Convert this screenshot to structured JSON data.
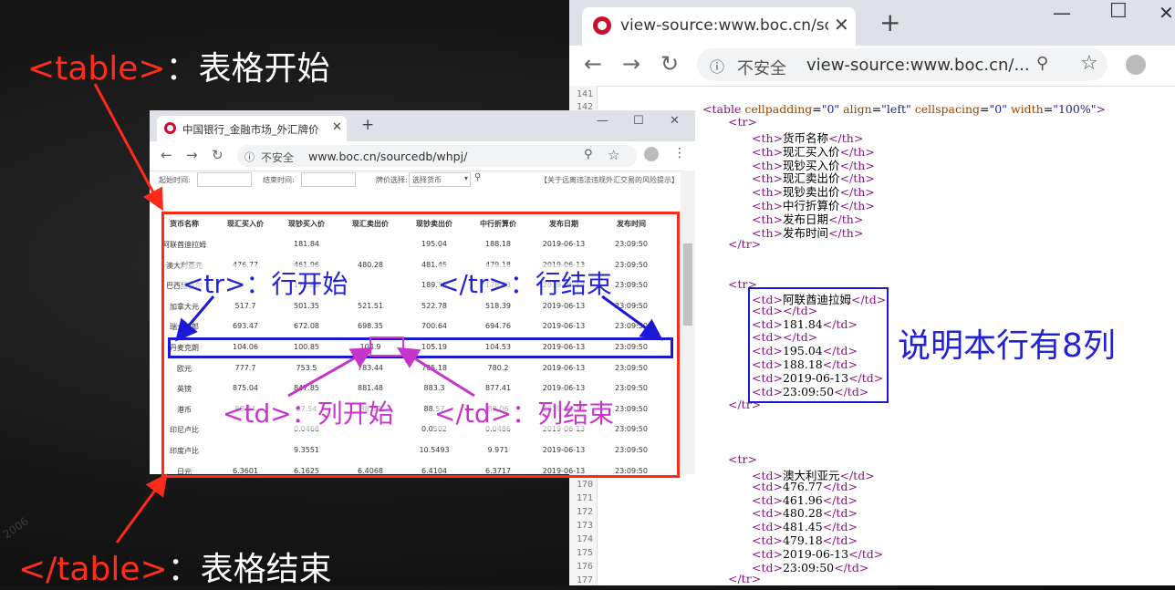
{
  "slide": {
    "table_open_tag": "<table>",
    "table_open_desc": "：表格开始",
    "table_close_tag": "</table>",
    "table_close_desc": "：表格结束",
    "tr_open": "<tr>：行开始",
    "tr_close": "</tr>：行结束",
    "td_open": "<td>：列开始",
    "td_close": "</td>：列结束",
    "note": "说明本行有8列",
    "watermark": "2006"
  },
  "right_browser": {
    "tab_title": "view-source:www.boc.cn/sourc",
    "insecure": "不安全",
    "url": "view-source:www.boc.cn/...",
    "line_numbers_top": [
      "141",
      "142"
    ],
    "line_numbers_bottom": [
      "170",
      "171",
      "172",
      "173",
      "174",
      "175",
      "176",
      "177"
    ],
    "source": {
      "table_line": "<table cellpadding=\"0\" align=\"left\" cellspacing=\"0\" width=\"100%\">",
      "tr": "<tr>",
      "tr_close": "</tr>",
      "th_rows": [
        "<th>货币名称</th>",
        "<th>现汇买入价</th>",
        "<th>现钞买入价</th>",
        "<th>现汇卖出价</th>",
        "<th>现钞卖出价</th>",
        "<th>中行折算价</th>",
        "<th>发布日期</th>",
        "<th>发布时间</th>"
      ],
      "td_rows_1": [
        "<td>阿联酋迪拉姆</td>",
        "<td></td>",
        "<td>181.84</td>",
        "<td></td>",
        "<td>195.04</td>",
        "<td>188.18</td>",
        "<td>2019-06-13</td>",
        "<td>23:09:50</td>"
      ],
      "td_rows_2": [
        "<td>澳大利亚元</td>",
        "<td>476.77</td>",
        "<td>461.96</td>",
        "<td>480.28</td>",
        "<td>481.45</td>",
        "<td>479.18</td>",
        "<td>2019-06-13</td>",
        "<td>23:09:50</td>"
      ]
    }
  },
  "small_browser": {
    "tab_title": "中国银行_金融市场_外汇牌价",
    "insecure": "不安全",
    "url": "www.boc.cn/sourcedb/whpj/",
    "filters": {
      "start_label": "起始时间:",
      "end_label": "结束时间:",
      "currency_label": "牌价选择:",
      "currency_value": "选择货币",
      "risk_link": "【关于远离违法违规外汇交易的风险提示】"
    },
    "headers": [
      "货币名称",
      "现汇买入价",
      "现钞买入价",
      "现汇卖出价",
      "现钞卖出价",
      "中行折算价",
      "发布日期",
      "发布时间"
    ],
    "rows": [
      [
        "阿联酋迪拉姆",
        "",
        "181.84",
        "",
        "195.04",
        "188.18",
        "2019-06-13",
        "23:09:50"
      ],
      [
        "澳大利亚元",
        "476.77",
        "461.96",
        "480.28",
        "481.45",
        "479.18",
        "2019-06-13",
        "23:09:50"
      ],
      [
        "巴西里亚尔",
        "",
        "171.86",
        "",
        "189.56",
        "178.93",
        "2019-06-13",
        "23:09:50"
      ],
      [
        "加拿大元",
        "517.7",
        "501.35",
        "521.51",
        "522.78",
        "518.39",
        "2019-06-13",
        "23:09:50"
      ],
      [
        "瑞士法郎",
        "693.47",
        "672.08",
        "698.35",
        "700.64",
        "694.76",
        "2019-06-13",
        "23:09:50"
      ],
      [
        "丹麦克朗",
        "104.06",
        "100.85",
        "104.9",
        "105.19",
        "104.53",
        "2019-06-13",
        "23:09:50"
      ],
      [
        "欧元",
        "777.7",
        "753.5",
        "783.44",
        "785.18",
        "780.2",
        "2019-06-13",
        "23:09:50"
      ],
      [
        "英镑",
        "875.04",
        "847.85",
        "881.48",
        "883.3",
        "877.41",
        "2019-06-13",
        "23:09:50"
      ],
      [
        "港币",
        "88.24",
        "87.54",
        "88.57",
        "88.57",
        "88.06",
        "2019-06-13",
        "23:09:50"
      ],
      [
        "印尼卢比",
        "",
        "0.0468",
        "",
        "0.0502",
        "0.0486",
        "2019-06-13",
        "23:09:50"
      ],
      [
        "印度卢比",
        "",
        "9.3551",
        "",
        "10.5493",
        "9.971",
        "2019-06-13",
        "23:09:50"
      ],
      [
        "日元",
        "6.3601",
        "6.1625",
        "6.4068",
        "6.4104",
        "6.3717",
        "2019-06-13",
        "23:09:50"
      ]
    ]
  }
}
